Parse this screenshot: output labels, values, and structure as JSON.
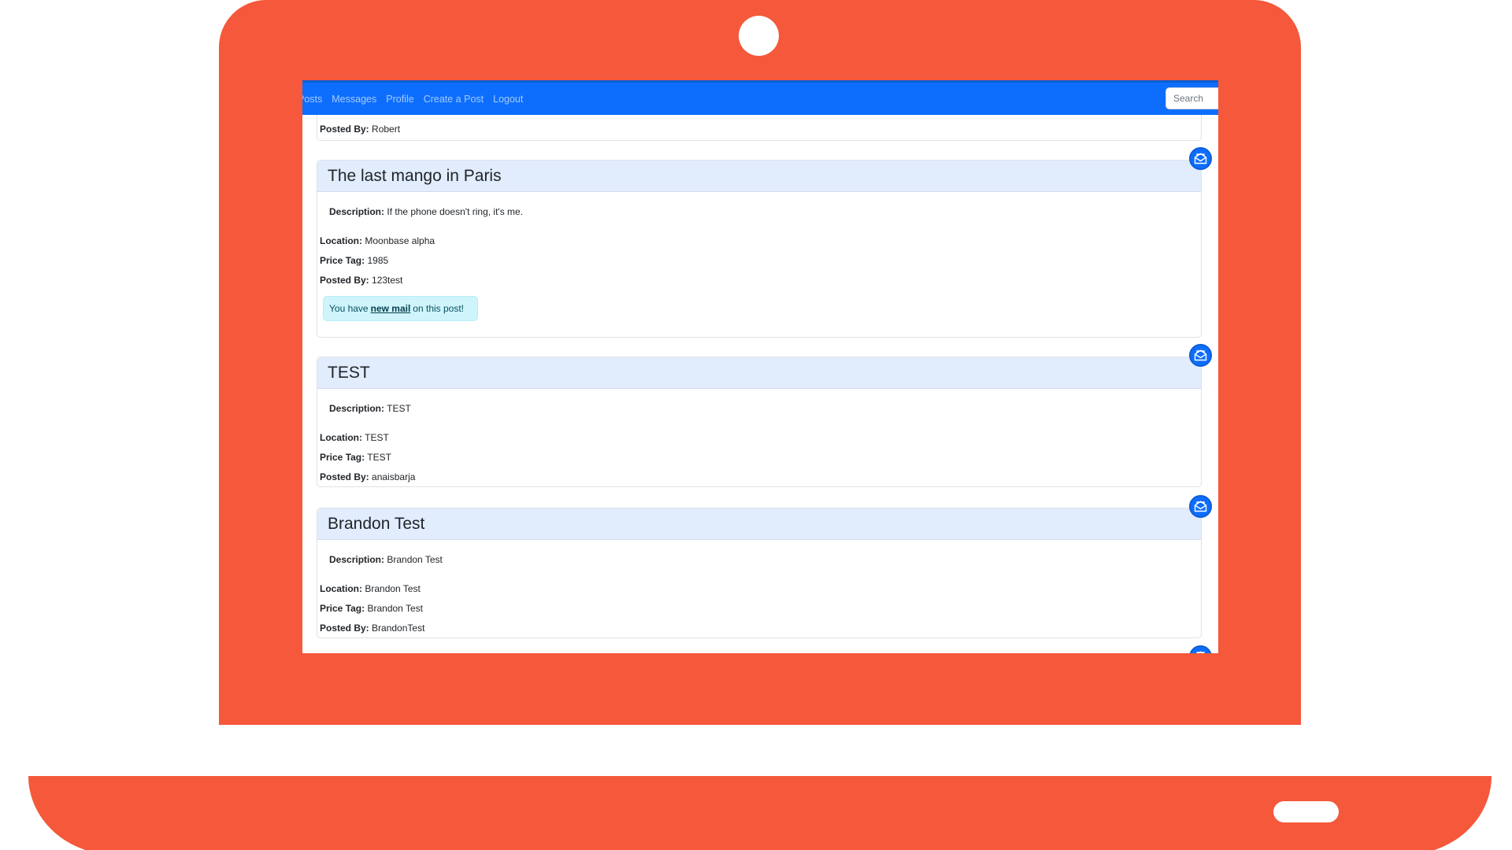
{
  "navbar": {
    "links": [
      "Posts",
      "Messages",
      "Profile",
      "Create a Post",
      "Logout"
    ],
    "search_placeholder": "Search"
  },
  "previous_post": {
    "posted_by_label": "Posted By:",
    "posted_by": "Robert"
  },
  "posts": [
    {
      "title": "The last mango in Paris",
      "description_label": "Description:",
      "description": "If the phone doesn't ring, it's me.",
      "location_label": "Location:",
      "location": "Moonbase alpha",
      "price_label": "Price Tag:",
      "price": "1985",
      "posted_by_label": "Posted By:",
      "posted_by": "123test",
      "alert": {
        "prefix": "You have",
        "link": "new mail",
        "suffix": "on this post!"
      }
    },
    {
      "title": "TEST",
      "description_label": "Description:",
      "description": "TEST",
      "location_label": "Location:",
      "location": "TEST",
      "price_label": "Price Tag:",
      "price": "TEST",
      "posted_by_label": "Posted By:",
      "posted_by": "anaisbarja"
    },
    {
      "title": "Brandon Test",
      "description_label": "Description:",
      "description": "Brandon Test",
      "location_label": "Location:",
      "location": "Brandon Test",
      "price_label": "Price Tag:",
      "price": "Brandon Test",
      "posted_by_label": "Posted By:",
      "posted_by": "BrandonTest"
    }
  ],
  "icons": {
    "message": "envelope-open-icon"
  },
  "colors": {
    "laptop": "#F5583A",
    "navbar": "#0d6efd",
    "card_header": "#e1ecfd",
    "alert_bg": "#cff4fc",
    "alert_text": "#055160"
  }
}
